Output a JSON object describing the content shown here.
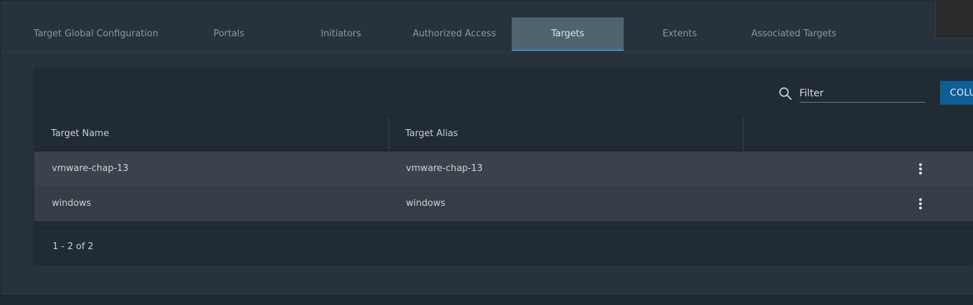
{
  "tabs": [
    {
      "label": "Target Global Configuration"
    },
    {
      "label": "Portals"
    },
    {
      "label": "Initiators"
    },
    {
      "label": "Authorized Access"
    },
    {
      "label": "Targets",
      "active": true
    },
    {
      "label": "Extents"
    },
    {
      "label": "Associated Targets"
    }
  ],
  "toolbar": {
    "filter_placeholder": "Filter",
    "columns_label": "COLU",
    "search_icon": "search-icon"
  },
  "table": {
    "columns": [
      "Target Name",
      "Target Alias",
      ""
    ],
    "rows": [
      {
        "name": "vmware-chap-13",
        "alias": "vmware-chap-13"
      },
      {
        "name": "windows",
        "alias": "windows"
      }
    ]
  },
  "pagination": {
    "range_text": "1 - 2 of 2"
  },
  "colors": {
    "accent": "#0f5e96",
    "active_tab_bg": "#4f6470",
    "active_tab_border": "#3f8ec2"
  }
}
